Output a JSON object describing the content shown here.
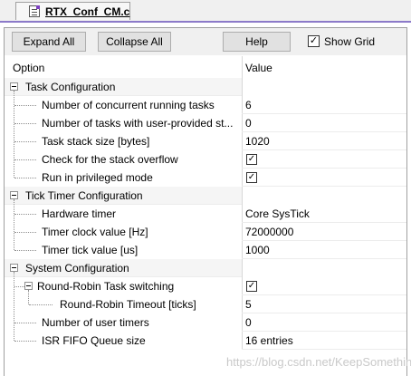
{
  "tab": {
    "label": "RTX_Conf_CM.c"
  },
  "toolbar": {
    "expand_all": "Expand All",
    "collapse_all": "Collapse All",
    "help": "Help",
    "show_grid_label": "Show Grid",
    "show_grid_checked": true,
    "check_glyph": "✓"
  },
  "grid": {
    "col_option": "Option",
    "col_value": "Value",
    "groups": [
      {
        "label": "Task Configuration",
        "items": [
          {
            "label": "Number of concurrent running tasks",
            "value": "6"
          },
          {
            "label": "Number of tasks with user-provided st...",
            "value": "0"
          },
          {
            "label": "Task stack size [bytes]",
            "value": "1020"
          },
          {
            "label": "Check for the stack overflow",
            "checked": true
          },
          {
            "label": "Run in privileged mode",
            "checked": true
          }
        ]
      },
      {
        "label": "Tick Timer Configuration",
        "items": [
          {
            "label": "Hardware timer",
            "value": "Core SysTick"
          },
          {
            "label": "Timer clock value [Hz]",
            "value": "72000000"
          },
          {
            "label": "Timer tick value [us]",
            "value": "1000"
          }
        ]
      },
      {
        "label": "System Configuration",
        "items": [
          {
            "label": "Round-Robin Task switching",
            "checked": true
          },
          {
            "label": "Round-Robin Timeout [ticks]",
            "value": "5"
          },
          {
            "label": "Number of user timers",
            "value": "0"
          },
          {
            "label": "ISR FIFO Queue size",
            "value": "16 entries"
          }
        ]
      }
    ]
  },
  "watermark": "https://blog.csdn.net/KeepSomething"
}
